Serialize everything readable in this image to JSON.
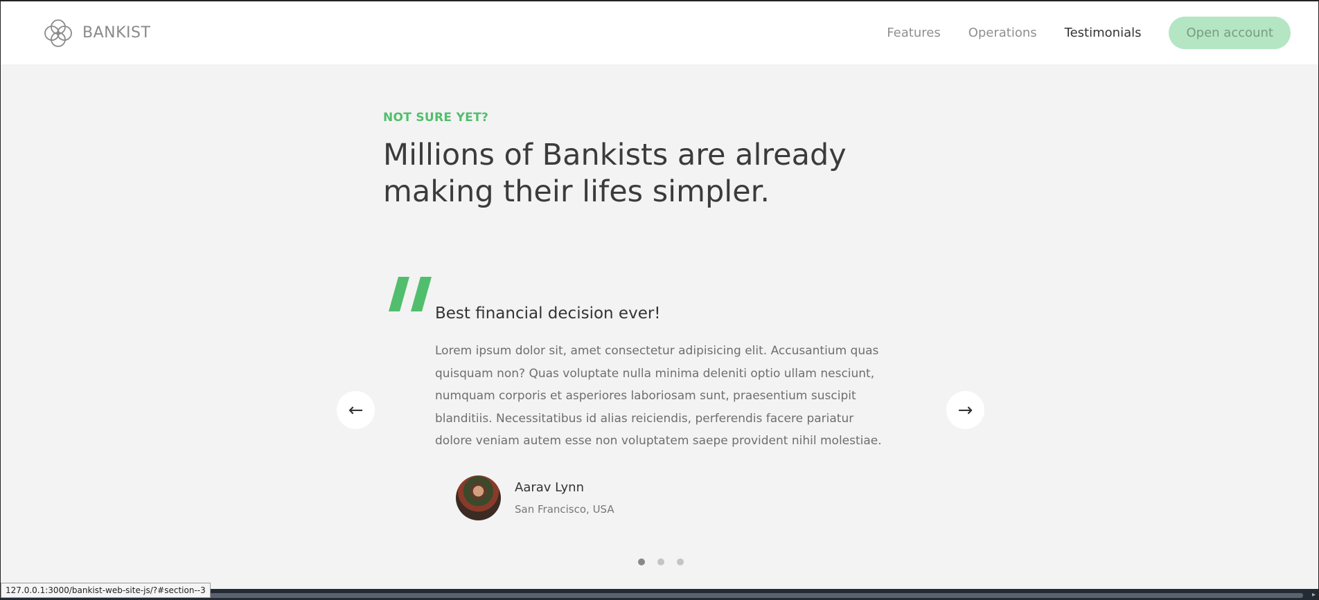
{
  "nav": {
    "logo_text": "BANKIST",
    "links": [
      {
        "label": "Features"
      },
      {
        "label": "Operations"
      },
      {
        "label": "Testimonials"
      }
    ],
    "cta_label": "Open account"
  },
  "section": {
    "tag": "NOT SURE YET?",
    "title": "Millions of Bankists are already making their lifes simpler."
  },
  "testimonial": {
    "headline": "Best financial decision ever!",
    "body": "Lorem ipsum dolor sit, amet consectetur adipisicing elit. Accusantium quas quisquam non? Quas voluptate nulla minima deleniti optio ullam nesciunt, numquam corporis et asperiores laboriosam sunt, praesentium suscipit blanditiis. Necessitatibus id alias reiciendis, perferendis facere pariatur dolore veniam autem esse non voluptatem saepe provident nihil molestiae.",
    "author_name": "Aarav Lynn",
    "author_location": "San Francisco, USA"
  },
  "slider": {
    "prev_label": "←",
    "next_label": "→",
    "dots_count": 3,
    "active_dot": 1
  },
  "status_bar": {
    "url": "127.0.0.1:3000/bankist-web-site-js/?#section--3"
  },
  "colors": {
    "accent": "#51be6d",
    "cta_bg": "#b4e6c3",
    "background": "#f3f3f3"
  },
  "icons": [
    "logo-icon",
    "quote-icon",
    "arrow-left-icon",
    "arrow-right-icon"
  ]
}
